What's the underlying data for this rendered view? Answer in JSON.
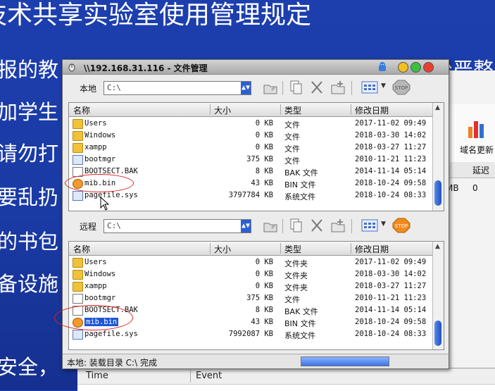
{
  "slide": {
    "title": "技术共享实验室使用管理规定",
    "lines": [
      "报的教",
      "加学生",
      "请勿打",
      "要乱扔",
      "的书包",
      "备设施",
      "安全，"
    ],
    "tail_right": "。但特整治严整"
  },
  "background_window": {
    "toolbar_label": "域名更新",
    "column_header": "延迟",
    "row_value_a": "MB",
    "row_value_b": "0"
  },
  "log_window": {
    "col_time": "Time",
    "col_event": "Event"
  },
  "file_manager": {
    "title": "\\\\192.168.31.116 - 文件管理",
    "local": {
      "label": "本地",
      "path": "C:\\",
      "columns": {
        "name": "名称",
        "size": "大小",
        "type": "类型",
        "date": "修改日期"
      },
      "files": [
        {
          "name": "Users",
          "size": "0 KB",
          "type": "文件",
          "date": "2017-11-02 09:49",
          "icon": "folder-icon"
        },
        {
          "name": "Windows",
          "size": "0 KB",
          "type": "文件",
          "date": "2018-03-30 14:02",
          "icon": "folder-icon"
        },
        {
          "name": "xampp",
          "size": "0 KB",
          "type": "文件",
          "date": "2018-03-27 11:27",
          "icon": "folder-icon"
        },
        {
          "name": "bootmgr",
          "size": "375 KB",
          "type": "文件",
          "date": "2010-11-21 11:23",
          "icon": "system-file-icon"
        },
        {
          "name": "BOOTSECT.BAK",
          "size": "8 KB",
          "type": "BAK 文件",
          "date": "2014-11-14 05:14",
          "icon": "file-icon"
        },
        {
          "name": "mib.bin",
          "size": "43 KB",
          "type": "BIN 文件",
          "date": "2018-10-24 09:58",
          "icon": "mib-file-icon"
        },
        {
          "name": "pagefile.sys",
          "size": "3797784 KB",
          "type": "系统文件",
          "date": "2018-10-24 08:33",
          "icon": "system-file-icon"
        }
      ]
    },
    "remote": {
      "label": "远程",
      "path": "C:\\",
      "columns": {
        "name": "名称",
        "size": "大小",
        "type": "类型",
        "date": "修改日期"
      },
      "files": [
        {
          "name": "Users",
          "size": "0 KB",
          "type": "文件夹",
          "date": "2017-11-02 09:49",
          "icon": "folder-icon"
        },
        {
          "name": "Windows",
          "size": "0 KB",
          "type": "文件夹",
          "date": "2018-03-30 14:02",
          "icon": "folder-icon"
        },
        {
          "name": "xampp",
          "size": "0 KB",
          "type": "文件夹",
          "date": "2018-03-27 11:27",
          "icon": "folder-icon"
        },
        {
          "name": "bootmgr",
          "size": "375 KB",
          "type": "文件",
          "date": "2010-11-21 11:23",
          "icon": "file-icon"
        },
        {
          "name": "BOOTSECT.BAK",
          "size": "8 KB",
          "type": "BAK 文件",
          "date": "2014-11-14 05:14",
          "icon": "file-icon"
        },
        {
          "name": "mib.bin",
          "size": "43 KB",
          "type": "BIN 文件",
          "date": "2018-10-24 09:58",
          "icon": "mib-file-icon",
          "selected": true
        },
        {
          "name": "pagefile.sys",
          "size": "7992087 KB",
          "type": "系统文件",
          "date": "2018-10-24 08:33",
          "icon": "system-file-icon"
        }
      ]
    },
    "status_text": "本地: 装载目录 C:\\ 完成",
    "progress": 1.0,
    "stop_label": "STOP"
  }
}
